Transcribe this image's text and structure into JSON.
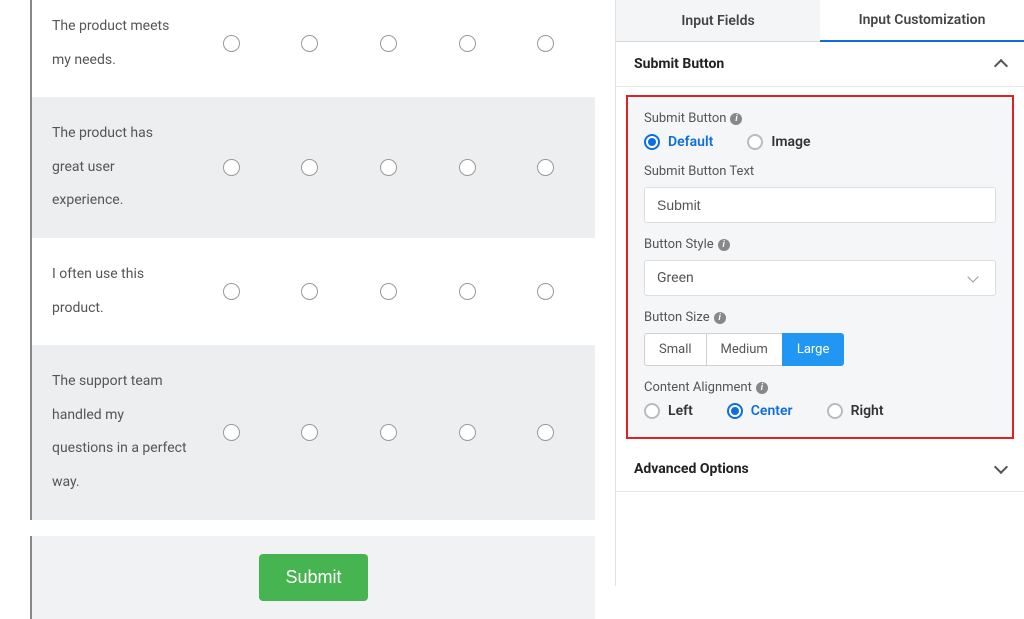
{
  "survey": {
    "questions": [
      "The product meets my needs.",
      "The product has great user experience.",
      "I often use this product.",
      "The support team handled my questions in a perfect way."
    ],
    "submit_label": "Submit"
  },
  "tabs": {
    "input_fields": "Input Fields",
    "input_customization": "Input Customization"
  },
  "sections": {
    "submit_button": "Submit Button",
    "advanced_options": "Advanced Options"
  },
  "settings": {
    "submit_button_type_label": "Submit Button",
    "type_options": {
      "default": "Default",
      "image": "Image"
    },
    "submit_button_text_label": "Submit Button Text",
    "submit_button_text_value": "Submit",
    "button_style_label": "Button Style",
    "button_style_value": "Green",
    "button_size_label": "Button Size",
    "size_options": {
      "small": "Small",
      "medium": "Medium",
      "large": "Large"
    },
    "content_alignment_label": "Content Alignment",
    "alignment_options": {
      "left": "Left",
      "center": "Center",
      "right": "Right"
    }
  }
}
